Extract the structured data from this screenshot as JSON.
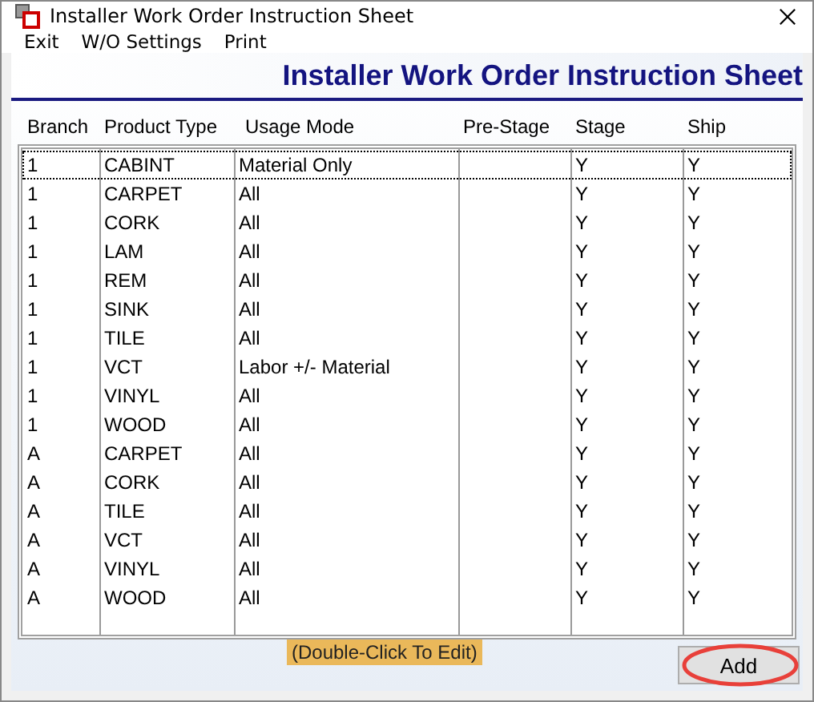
{
  "window": {
    "title": "Installer Work Order Instruction Sheet"
  },
  "menu": [
    "Exit",
    "W/O Settings",
    "Print"
  ],
  "banner": "Installer Work Order Instruction Sheet",
  "table": {
    "columns": [
      "Branch",
      "Product Type",
      "Usage Mode",
      "Pre-Stage",
      "Stage",
      "Ship"
    ],
    "rows": [
      {
        "cells": [
          "1",
          "CABINT",
          "Material Only",
          "",
          "Y",
          "Y"
        ],
        "selected": true
      },
      {
        "cells": [
          "1",
          "CARPET",
          "All",
          "",
          "Y",
          "Y"
        ],
        "selected": false
      },
      {
        "cells": [
          "1",
          "CORK",
          "All",
          "",
          "Y",
          "Y"
        ],
        "selected": false
      },
      {
        "cells": [
          "1",
          "LAM",
          "All",
          "",
          "Y",
          "Y"
        ],
        "selected": false
      },
      {
        "cells": [
          "1",
          "REM",
          "All",
          "",
          "Y",
          "Y"
        ],
        "selected": false
      },
      {
        "cells": [
          "1",
          "SINK",
          "All",
          "",
          "Y",
          "Y"
        ],
        "selected": false
      },
      {
        "cells": [
          "1",
          "TILE",
          "All",
          "",
          "Y",
          "Y"
        ],
        "selected": false
      },
      {
        "cells": [
          "1",
          "VCT",
          "Labor +/- Material",
          "",
          "Y",
          "Y"
        ],
        "selected": false
      },
      {
        "cells": [
          "1",
          "VINYL",
          "All",
          "",
          "Y",
          "Y"
        ],
        "selected": false
      },
      {
        "cells": [
          "1",
          "WOOD",
          "All",
          "",
          "Y",
          "Y"
        ],
        "selected": false
      },
      {
        "cells": [
          "A",
          "CARPET",
          "All",
          "",
          "Y",
          "Y"
        ],
        "selected": false
      },
      {
        "cells": [
          "A",
          "CORK",
          "All",
          "",
          "Y",
          "Y"
        ],
        "selected": false
      },
      {
        "cells": [
          "A",
          "TILE",
          "All",
          "",
          "Y",
          "Y"
        ],
        "selected": false
      },
      {
        "cells": [
          "A",
          "VCT",
          "All",
          "",
          "Y",
          "Y"
        ],
        "selected": false
      },
      {
        "cells": [
          "A",
          "VINYL",
          "All",
          "",
          "Y",
          "Y"
        ],
        "selected": false
      },
      {
        "cells": [
          "A",
          "WOOD",
          "All",
          "",
          "Y",
          "Y"
        ],
        "selected": false
      }
    ]
  },
  "hint": "(Double-Click To Edit)",
  "buttons": [
    {
      "label": "Add",
      "highlighted": true
    }
  ]
}
